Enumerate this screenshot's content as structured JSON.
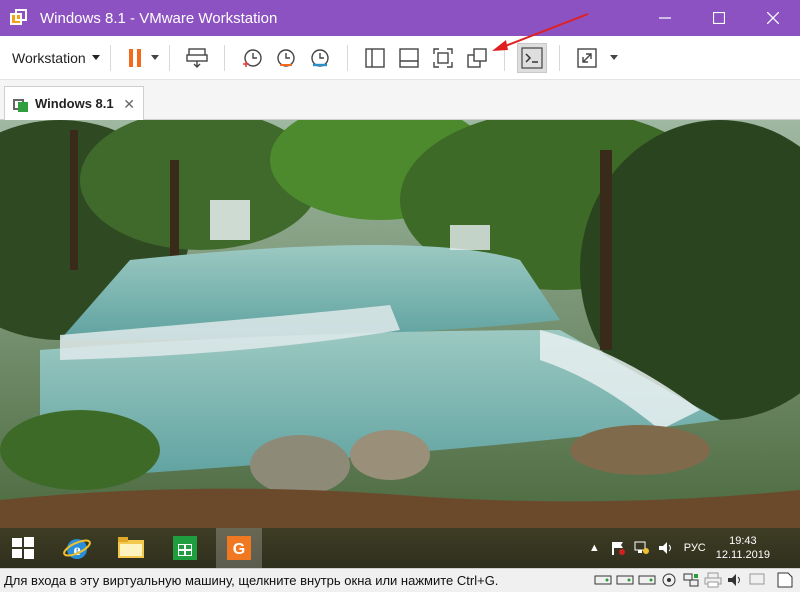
{
  "window": {
    "title": "Windows 8.1 - VMware Workstation",
    "controls": [
      "minimize-icon",
      "maximize-icon",
      "close-icon"
    ]
  },
  "toolbar": {
    "workstation_menu": "Workstation",
    "buttons": [
      "pause-icon",
      "send-ctrl-alt-del-icon",
      "snapshot-take-icon",
      "snapshot-revert-icon",
      "snapshot-manager-icon",
      "library-view-icon",
      "thumbnail-bar-icon",
      "full-screen-icon",
      "unity-icon",
      "console-view-icon",
      "stretch-guest-icon"
    ]
  },
  "tabs": [
    {
      "label": "Windows 8.1",
      "icon": "vm-tab-icon"
    }
  ],
  "guest_taskbar": {
    "pinned": [
      "windows-start-icon",
      "internet-explorer-icon",
      "file-explorer-icon",
      "windows-store-icon",
      "app-g-icon"
    ],
    "tray": {
      "language": "РУС",
      "time": "19:43",
      "date": "12.11.2019"
    }
  },
  "statusbar": {
    "message": "Для входа в эту виртуальную машину, щелкните внутрь окна или нажмите Ctrl+G.",
    "icons": [
      "hdd-icon",
      "hdd2-icon",
      "hdd3-icon",
      "cd-icon",
      "network-icon",
      "printer-icon",
      "sound-icon",
      "display-icon",
      "message-icon"
    ]
  },
  "colors": {
    "titlebar": "#8c52c1",
    "pause": "#f26b1d",
    "annotation_arrow": "#e02020"
  }
}
